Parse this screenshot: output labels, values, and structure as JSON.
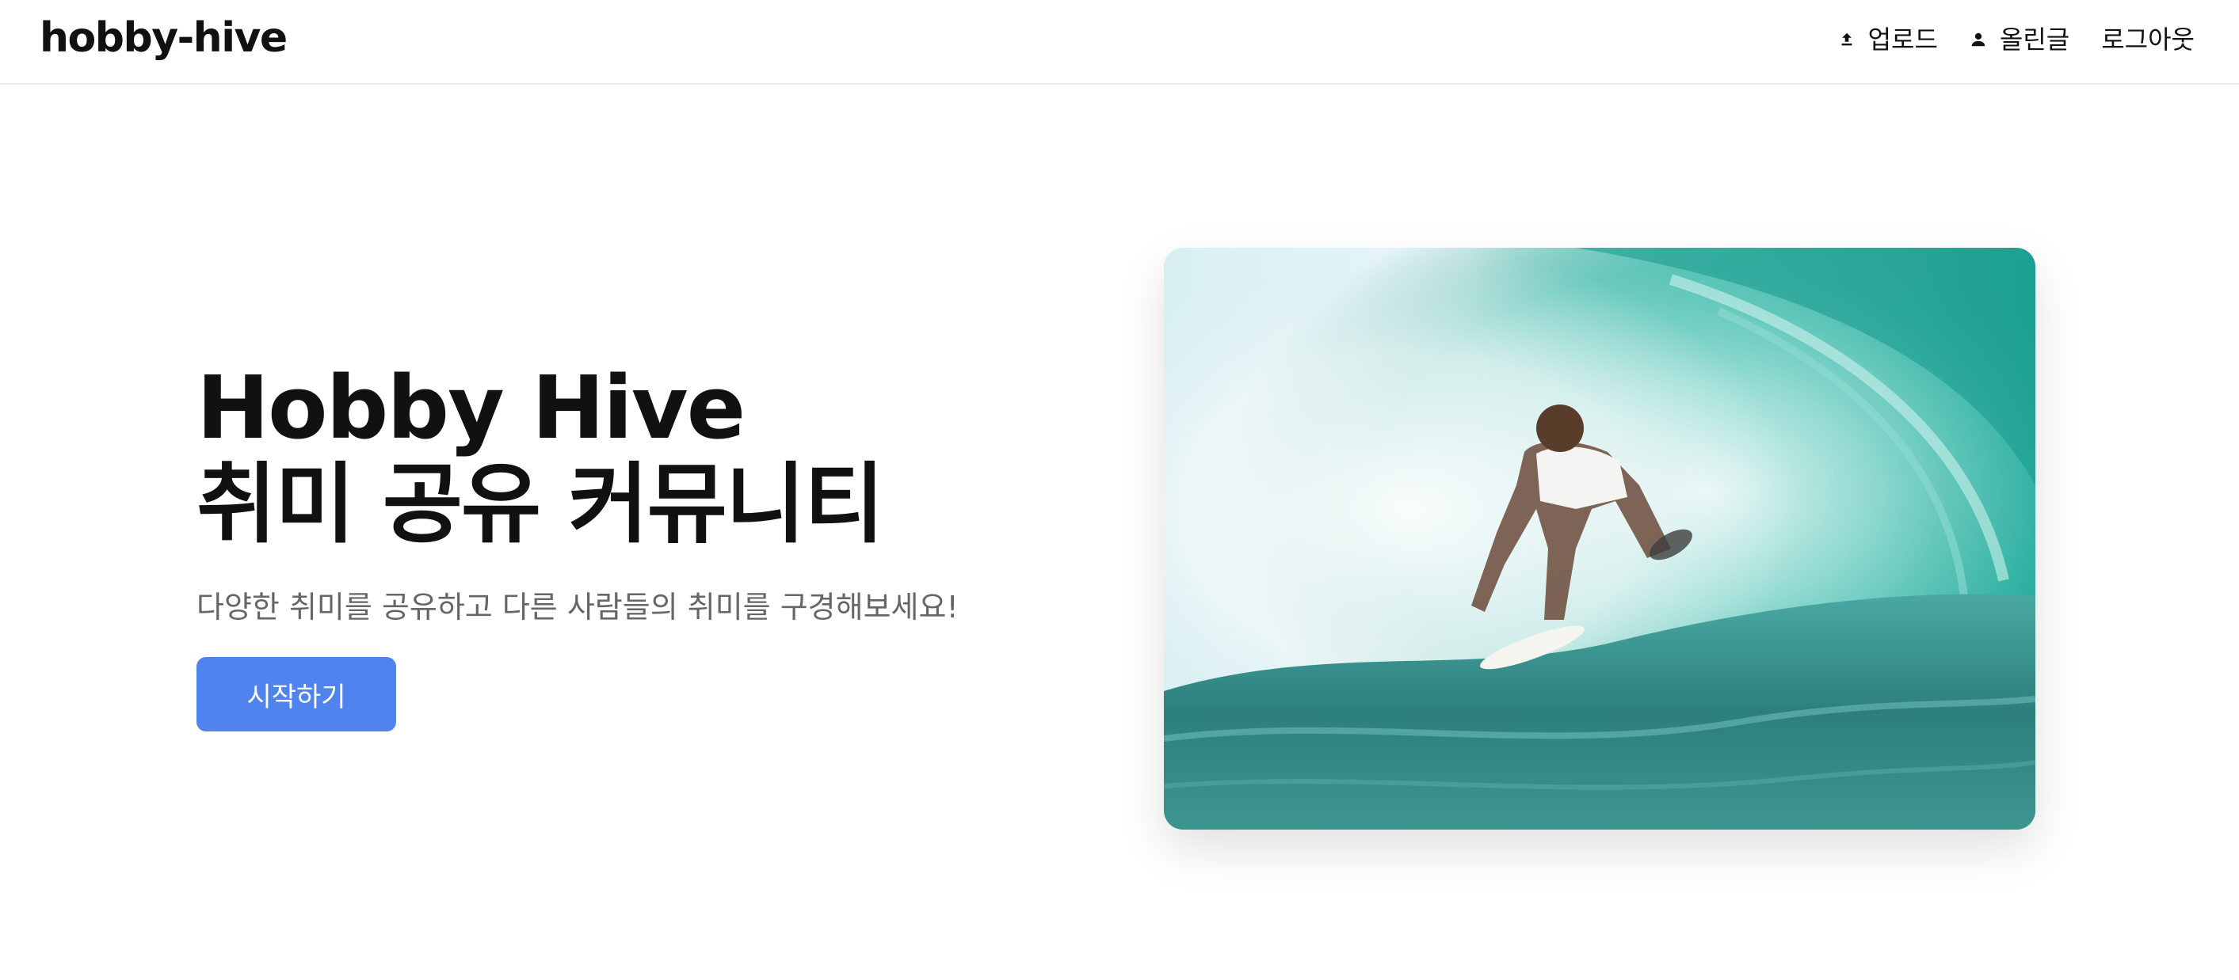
{
  "header": {
    "logo": "hobby-hive",
    "nav": {
      "upload": {
        "label": "업로드",
        "icon": "upload-icon"
      },
      "my_posts": {
        "label": "올린글",
        "icon": "person-icon"
      },
      "logout": {
        "label": "로그아웃"
      }
    }
  },
  "hero": {
    "title_line1": "Hobby Hive",
    "title_line2": "취미 공유 커뮤니티",
    "subtitle": "다양한 취미를 공유하고 다른 사람들의 취미를 구경해보세요!",
    "cta_label": "시작하기",
    "image": "surfer-in-wave-photo"
  },
  "colors": {
    "accent": "#5083ee",
    "text": "#111111",
    "subtext": "#666666",
    "border": "#ececec"
  }
}
